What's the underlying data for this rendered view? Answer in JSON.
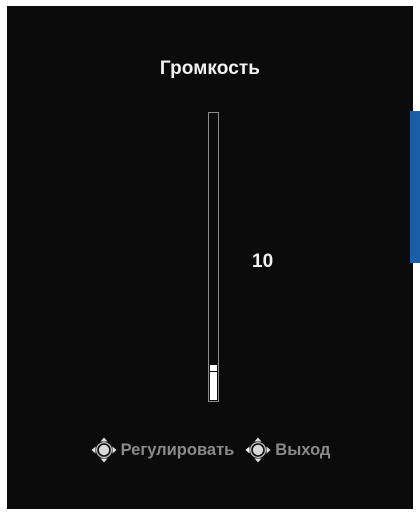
{
  "osd": {
    "title": "Громкость",
    "value": "10",
    "volume_level_percent": 10,
    "accent_color": "#1a5ea8",
    "hints": [
      {
        "icon": "joystick-adjust-icon",
        "label": "Регулировать"
      },
      {
        "icon": "joystick-exit-icon",
        "label": "Выход"
      }
    ]
  }
}
